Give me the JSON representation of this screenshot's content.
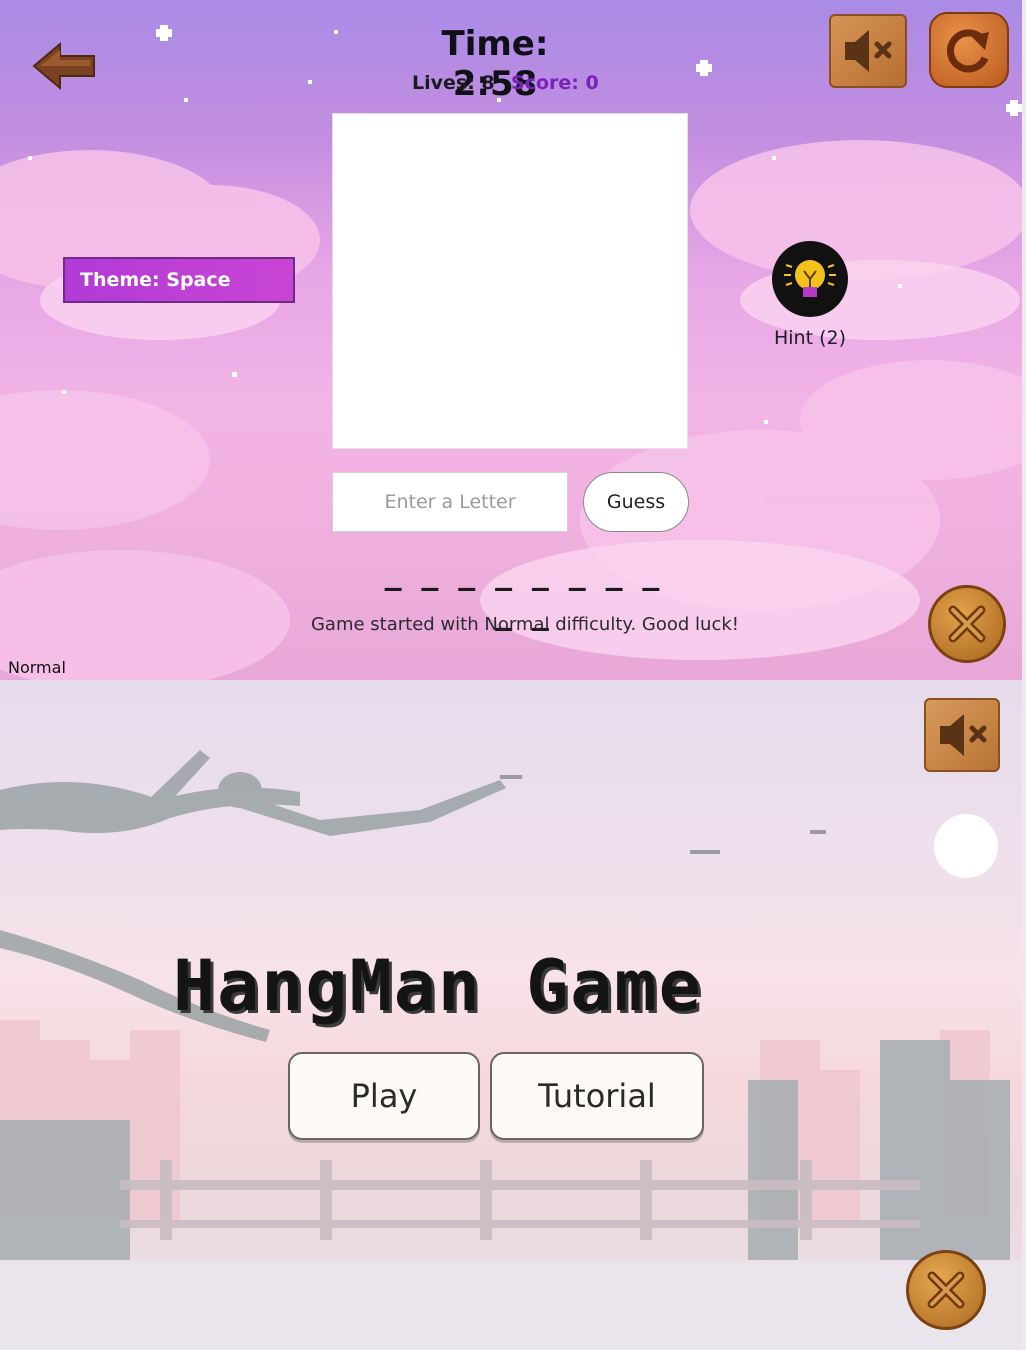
{
  "game": {
    "time_label": "Time: 2:58",
    "lives_label": "Lives: 8",
    "score_label": "Score: 0",
    "theme_label": "Theme: Space",
    "hint_label": "Hint (2)",
    "letter_placeholder": "Enter a Letter",
    "guess_label": "Guess",
    "word_blanks": "_ _ _ _ _ _ _ _ _ _",
    "status_message": "Game started with Normal difficulty. Good luck!",
    "difficulty": "Normal"
  },
  "menu": {
    "title": "HangMan Game",
    "play_label": "Play",
    "tutorial_label": "Tutorial"
  },
  "icons": {
    "back": "back-arrow-icon",
    "mute": "speaker-mute-icon",
    "restart": "restart-icon",
    "hint": "lightbulb-icon",
    "close": "close-x-icon"
  },
  "colors": {
    "score": "#7a22b8",
    "theme_badge": "#c13fd5",
    "wood": "#c7813e"
  }
}
